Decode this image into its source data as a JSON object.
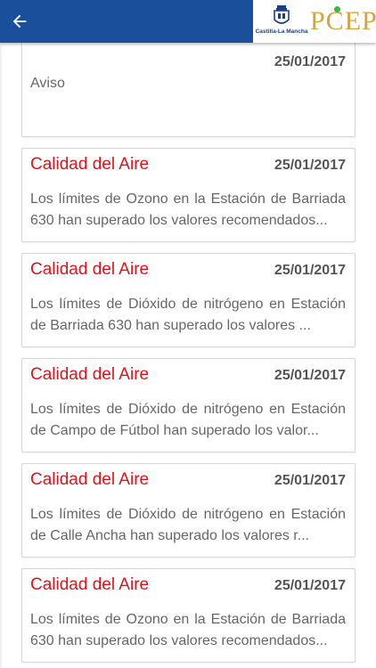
{
  "header": {
    "crest_caption": "Castilla-La Mancha",
    "logo_text": "PCEP",
    "colors": {
      "bar": "#1a4f9c",
      "logo": "#d8a33a",
      "logo_dot": "#3cb54a"
    }
  },
  "notifications": [
    {
      "title": "",
      "date": "25/01/2017",
      "body": "Aviso"
    },
    {
      "title": "Calidad del Aire",
      "date": "25/01/2017",
      "body": "Los límites de Ozono en la Estación de Barriada 630 han superado los valores recomendados..."
    },
    {
      "title": "Calidad del Aire",
      "date": "25/01/2017",
      "body": "Los límites de Dióxido de nitrógeno en Estación de Barriada 630 han superado los valores ..."
    },
    {
      "title": "Calidad del Aire",
      "date": "25/01/2017",
      "body": "Los límites de Dióxido de nitrógeno en Estación de Campo de Fútbol han superado los valor..."
    },
    {
      "title": "Calidad del Aire",
      "date": "25/01/2017",
      "body": "Los límites de Dióxido de nitrógeno en Estación de Calle Ancha han superado los valores r..."
    },
    {
      "title": "Calidad del Aire",
      "date": "25/01/2017",
      "body": "Los límites de Ozono en la Estación de Barriada 630 han superado los valores recomendados..."
    }
  ]
}
